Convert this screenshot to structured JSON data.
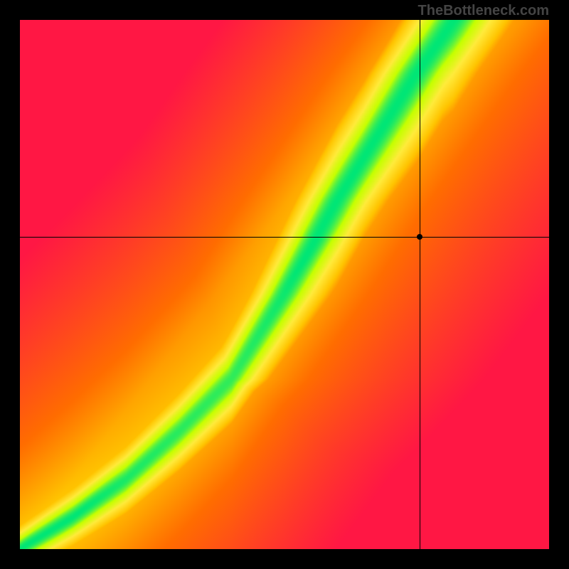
{
  "watermark": "TheBottleneck.com",
  "chart_data": {
    "type": "heatmap",
    "title": "",
    "xlabel": "",
    "ylabel": "",
    "xlim": [
      0,
      100
    ],
    "ylim": [
      0,
      100
    ],
    "marker": {
      "x": 75.5,
      "y": 59
    },
    "crosshair": {
      "x": 75.5,
      "y": 59
    },
    "colormap": {
      "stops": [
        {
          "value": 0.0,
          "color": "#FF1744"
        },
        {
          "value": 0.35,
          "color": "#FF6D00"
        },
        {
          "value": 0.55,
          "color": "#FFC400"
        },
        {
          "value": 0.75,
          "color": "#FFEB3B"
        },
        {
          "value": 0.9,
          "color": "#C6FF00"
        },
        {
          "value": 1.0,
          "color": "#00E676"
        }
      ]
    },
    "ridge_description": "Optimal (green) region follows a curved diagonal from bottom-left to upper-center, indicating balanced CPU/GPU pairing. Marker point sits right of optimal ridge in yellow zone.",
    "ridge_samples": [
      {
        "x": 0,
        "y": 0,
        "width": 1
      },
      {
        "x": 10,
        "y": 6,
        "width": 1.5
      },
      {
        "x": 20,
        "y": 13,
        "width": 2
      },
      {
        "x": 30,
        "y": 22,
        "width": 2.5
      },
      {
        "x": 40,
        "y": 32,
        "width": 3
      },
      {
        "x": 45,
        "y": 40,
        "width": 3.5
      },
      {
        "x": 50,
        "y": 48,
        "width": 4
      },
      {
        "x": 55,
        "y": 57,
        "width": 4.5
      },
      {
        "x": 60,
        "y": 66,
        "width": 5
      },
      {
        "x": 65,
        "y": 74,
        "width": 5
      },
      {
        "x": 70,
        "y": 82,
        "width": 5.5
      },
      {
        "x": 75,
        "y": 90,
        "width": 6
      },
      {
        "x": 80,
        "y": 97,
        "width": 6
      },
      {
        "x": 82,
        "y": 100,
        "width": 6.5
      }
    ]
  }
}
